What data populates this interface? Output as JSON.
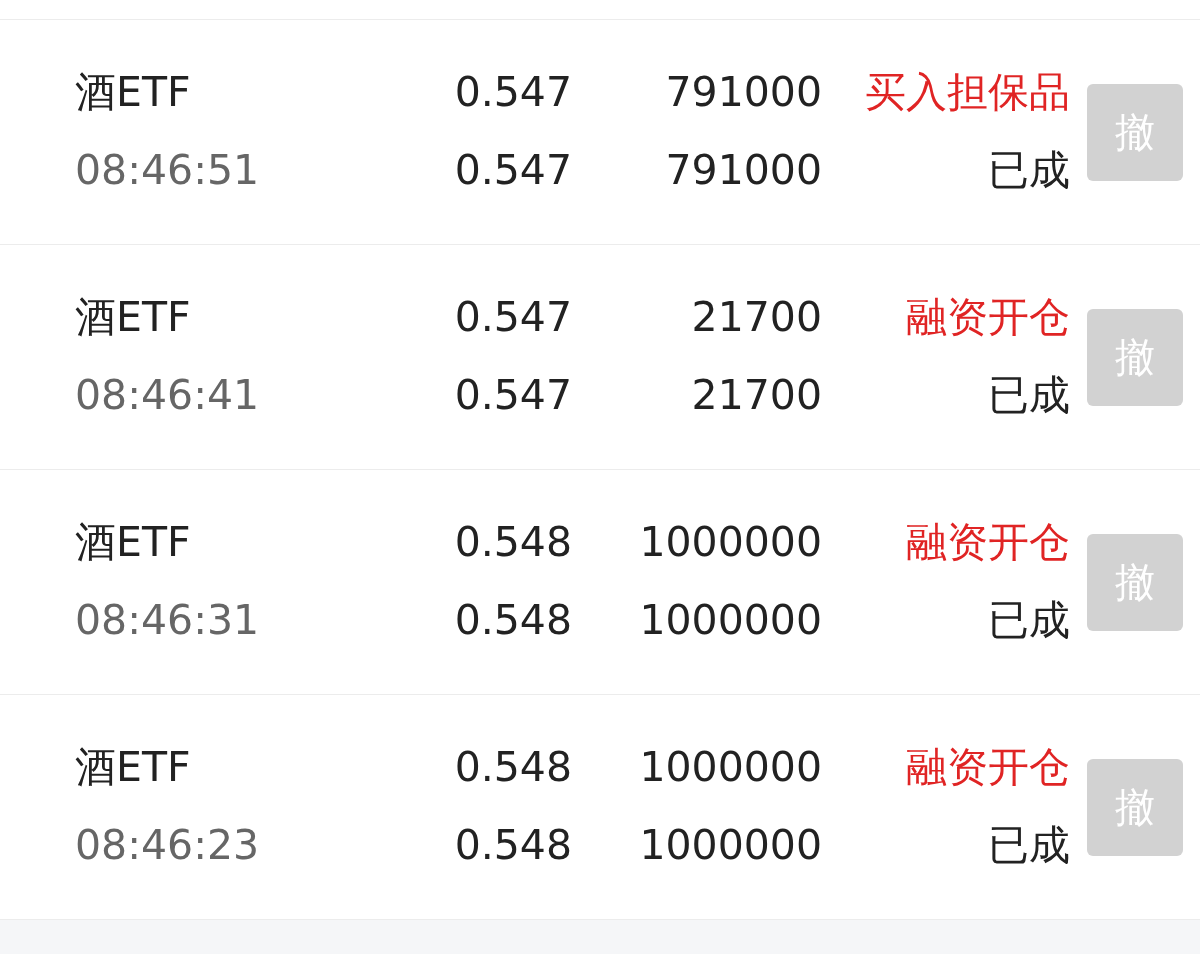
{
  "orders": [
    {
      "name": "酒ETF",
      "time": "08:46:51",
      "order_price": "0.547",
      "order_qty": "791000",
      "deal_price": "0.547",
      "deal_qty": "791000",
      "type": "买入担保品",
      "status": "已成",
      "cancel": {
        "label": "撤",
        "disabled": true
      }
    },
    {
      "name": "酒ETF",
      "time": "08:46:41",
      "order_price": "0.547",
      "order_qty": "21700",
      "deal_price": "0.547",
      "deal_qty": "21700",
      "type": "融资开仓",
      "status": "已成",
      "cancel": {
        "label": "撤",
        "disabled": true
      }
    },
    {
      "name": "酒ETF",
      "time": "08:46:31",
      "order_price": "0.548",
      "order_qty": "1000000",
      "deal_price": "0.548",
      "deal_qty": "1000000",
      "type": "融资开仓",
      "status": "已成",
      "cancel": {
        "label": "撤",
        "disabled": true
      }
    },
    {
      "name": "酒ETF",
      "time": "08:46:23",
      "order_price": "0.548",
      "order_qty": "1000000",
      "deal_price": "0.548",
      "deal_qty": "1000000",
      "type": "融资开仓",
      "status": "已成",
      "cancel": {
        "label": "撤",
        "disabled": true
      }
    }
  ]
}
